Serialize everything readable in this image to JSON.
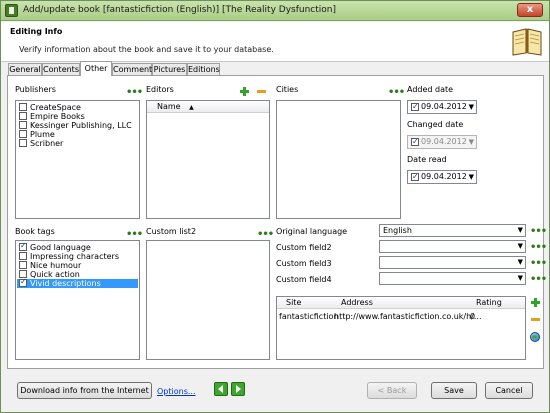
{
  "window": {
    "title": "Add/update book [fantasticfiction (English)] [The Reality Dysfunction]",
    "close": "x"
  },
  "header": {
    "title": "Editing Info",
    "subtitle": "Verify information about the book and save it to your database."
  },
  "tabs": [
    "General",
    "Contents",
    "Other",
    "Comment",
    "Pictures",
    "Editions"
  ],
  "active_tab": "Other",
  "publishers": {
    "label": "Publishers",
    "items": [
      "CreateSpace",
      "Empire Books",
      "Kessinger Publishing, LLC",
      "Plume",
      "Scribner"
    ]
  },
  "editors": {
    "label": "Editors",
    "column": "Name"
  },
  "cities": {
    "label": "Cities"
  },
  "dates": {
    "added_label": "Added date",
    "added_value": "09.04.2012",
    "changed_label": "Changed date",
    "changed_value": "09.04.2012",
    "read_label": "Date read",
    "read_value": "09.04.2012"
  },
  "book_tags": {
    "label": "Book tags",
    "items": [
      {
        "label": "Good language",
        "checked": true
      },
      {
        "label": "Impressing characters",
        "checked": false
      },
      {
        "label": "Nice humour",
        "checked": false
      },
      {
        "label": "Quick action",
        "checked": false
      },
      {
        "label": "Vivid descriptions",
        "checked": true
      }
    ]
  },
  "custom_list2": {
    "label": "Custom list2"
  },
  "fields": {
    "original_language_label": "Original language",
    "original_language_value": "English",
    "custom_field2_label": "Custom field2",
    "custom_field3_label": "Custom field3",
    "custom_field4_label": "Custom field4"
  },
  "sites_table": {
    "columns": [
      "Site",
      "Address",
      "Rating"
    ],
    "rows": [
      {
        "site": "fantasticfiction",
        "address": "http://www.fantasticfiction.co.uk/h/...",
        "rating": "0"
      }
    ]
  },
  "footer": {
    "download": "Download info from the Internet",
    "options": "Options...",
    "back": "< Back",
    "save": "Save",
    "cancel": "Cancel"
  }
}
